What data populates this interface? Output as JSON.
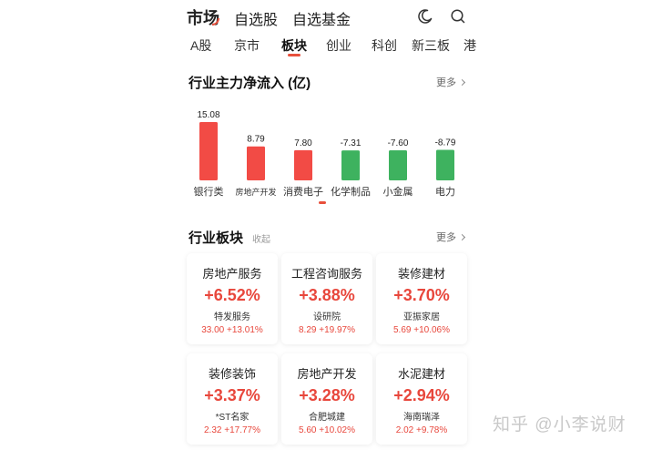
{
  "nav": {
    "active": "市场",
    "items": [
      "自选股",
      "自选基金"
    ]
  },
  "subtabs": [
    "A股",
    "京市",
    "板块",
    "创业",
    "科创",
    "新三板",
    "港"
  ],
  "flow": {
    "title": "行业主力净流入 (亿)",
    "more_label": "更多"
  },
  "chart_data": {
    "type": "bar",
    "categories": [
      "银行类",
      "房地产开发",
      "消费电子",
      "化学制品",
      "小金属",
      "电力"
    ],
    "values": [
      15.08,
      8.79,
      7.8,
      -7.31,
      -7.6,
      -8.79
    ],
    "value_labels": [
      "15.08",
      "8.79",
      "7.80",
      "-7.31",
      "-7.60",
      "-8.79"
    ],
    "title": "行业主力净流入 (亿)",
    "xlabel": "",
    "ylabel": "",
    "grid": false,
    "colors": {
      "positive": "#f24b45",
      "negative": "#3eb25f"
    }
  },
  "sectors": {
    "title": "行业板块",
    "collapse_label": "收起",
    "more_label": "更多",
    "cards": [
      {
        "name": "房地产服务",
        "pct": "+6.52%",
        "stock": "特发服务",
        "quote": "33.00  +13.01%"
      },
      {
        "name": "工程咨询服务",
        "pct": "+3.88%",
        "stock": "设研院",
        "quote": "8.29  +19.97%"
      },
      {
        "name": "装修建材",
        "pct": "+3.70%",
        "stock": "亚振家居",
        "quote": "5.69  +10.06%"
      },
      {
        "name": "装修装饰",
        "pct": "+3.37%",
        "stock": "*ST名家",
        "quote": "2.32  +17.77%"
      },
      {
        "name": "房地产开发",
        "pct": "+3.28%",
        "stock": "合肥城建",
        "quote": "5.60  +10.02%"
      },
      {
        "name": "水泥建材",
        "pct": "+2.94%",
        "stock": "海南瑞泽",
        "quote": "2.02  +9.78%"
      }
    ]
  },
  "watermark": "知乎 @小李说财",
  "colors": {
    "accent": "#e8503c",
    "up": "#e8473c",
    "down": "#3eb25f"
  },
  "icons": {
    "theme": "moon-icon",
    "search": "search-icon"
  }
}
